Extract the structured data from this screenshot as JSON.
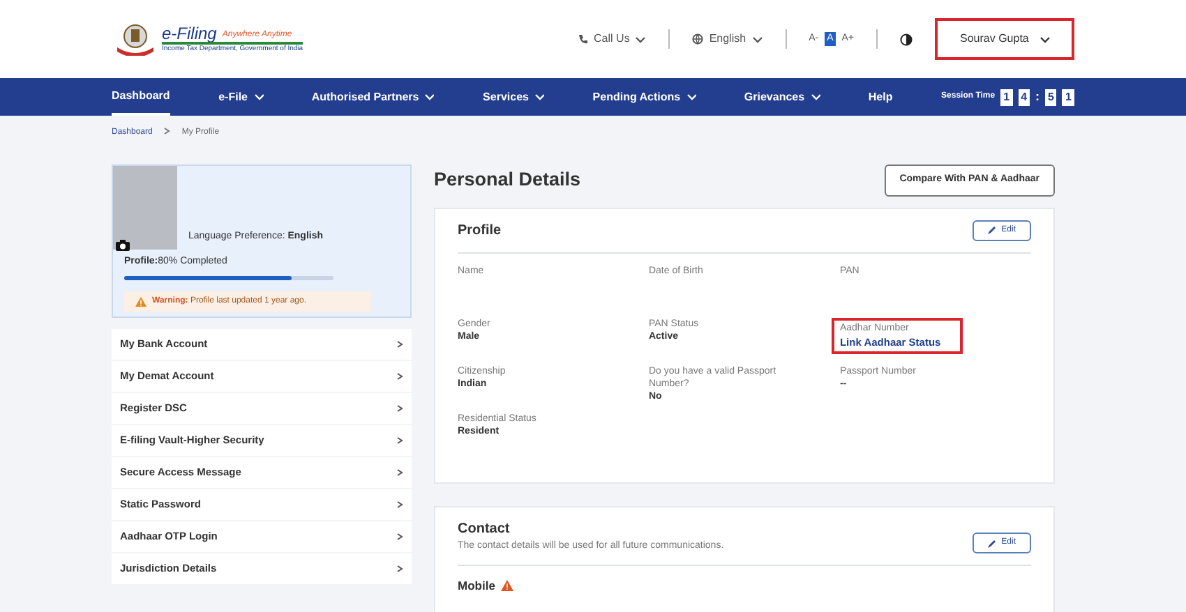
{
  "header": {
    "logo": {
      "title": "e-Filing",
      "tagline": "Anywhere Anytime",
      "subtitle": "Income Tax Department, Government of India"
    },
    "call_us": "Call Us",
    "language": "English",
    "font_sizes": [
      "A-",
      "A",
      "A+"
    ],
    "user": {
      "name": "Sourav Gupta",
      "highlighted": true
    }
  },
  "nav": {
    "items": [
      {
        "label": "Dashboard",
        "selected": true,
        "dropdown": false
      },
      {
        "label": "e-File",
        "selected": false,
        "dropdown": true
      },
      {
        "label": "Authorised Partners",
        "selected": false,
        "dropdown": true
      },
      {
        "label": "Services",
        "selected": false,
        "dropdown": true
      },
      {
        "label": "Pending Actions",
        "selected": false,
        "dropdown": true
      },
      {
        "label": "Grievances",
        "selected": false,
        "dropdown": true
      },
      {
        "label": "Help",
        "selected": false,
        "dropdown": false
      }
    ],
    "session_label": "Session Time",
    "session_digits": [
      "1",
      "4",
      ":",
      "5",
      "1"
    ]
  },
  "breadcrumb": [
    "Dashboard",
    "My Profile"
  ],
  "profile_card": {
    "language_label": "Language Preference:",
    "language_value": "English",
    "progress_label": "Profile:",
    "progress_text": "80% Completed",
    "level": 0.8,
    "warning_label": "Warning:",
    "warning_text": "Profile last updated 1 year ago."
  },
  "sidebar": {
    "items": [
      {
        "label": "My Bank Account"
      },
      {
        "label": "My Demat Account"
      },
      {
        "label": "Register DSC"
      },
      {
        "label": "E-filing Vault-Higher Security"
      },
      {
        "label": "Secure Access Message"
      },
      {
        "label": "Static Password"
      },
      {
        "label": "Aadhaar OTP Login"
      },
      {
        "label": "Jurisdiction Details"
      }
    ]
  },
  "page_title": "Personal Details",
  "compare_button": "Compare With PAN & Aadhaar",
  "profile_section": {
    "title": "Profile",
    "edit": "Edit",
    "fields": [
      {
        "label": "Name",
        "highlighted": false
      },
      {
        "label": "Date of Birth",
        "highlighted": false
      },
      {
        "label": "PAN",
        "highlighted": false
      },
      {
        "label": "Gender",
        "value": "Male",
        "kind": "text",
        "highlighted": false
      },
      {
        "label": "PAN Status",
        "value": "Active",
        "kind": "text",
        "highlighted": false
      },
      {
        "label": "Aadhar Number",
        "value": "Link Aadhaar Status",
        "kind": "link",
        "highlighted": true
      },
      {
        "label": "Citizenship",
        "value": "Indian",
        "kind": "text",
        "highlighted": false
      },
      {
        "label": "Do you have a valid Passport Number?",
        "value": "No",
        "kind": "text",
        "highlighted": false
      },
      {
        "label": "Passport Number",
        "value": "--",
        "kind": "text",
        "highlighted": false
      },
      {
        "label": "Residential Status",
        "value": "Resident",
        "kind": "text",
        "highlighted": false
      }
    ]
  },
  "contact_section": {
    "title": "Contact",
    "description": "The contact details will be used for all future communications.",
    "edit": "Edit",
    "mobile_label": "Mobile",
    "mobile_warning": true
  }
}
